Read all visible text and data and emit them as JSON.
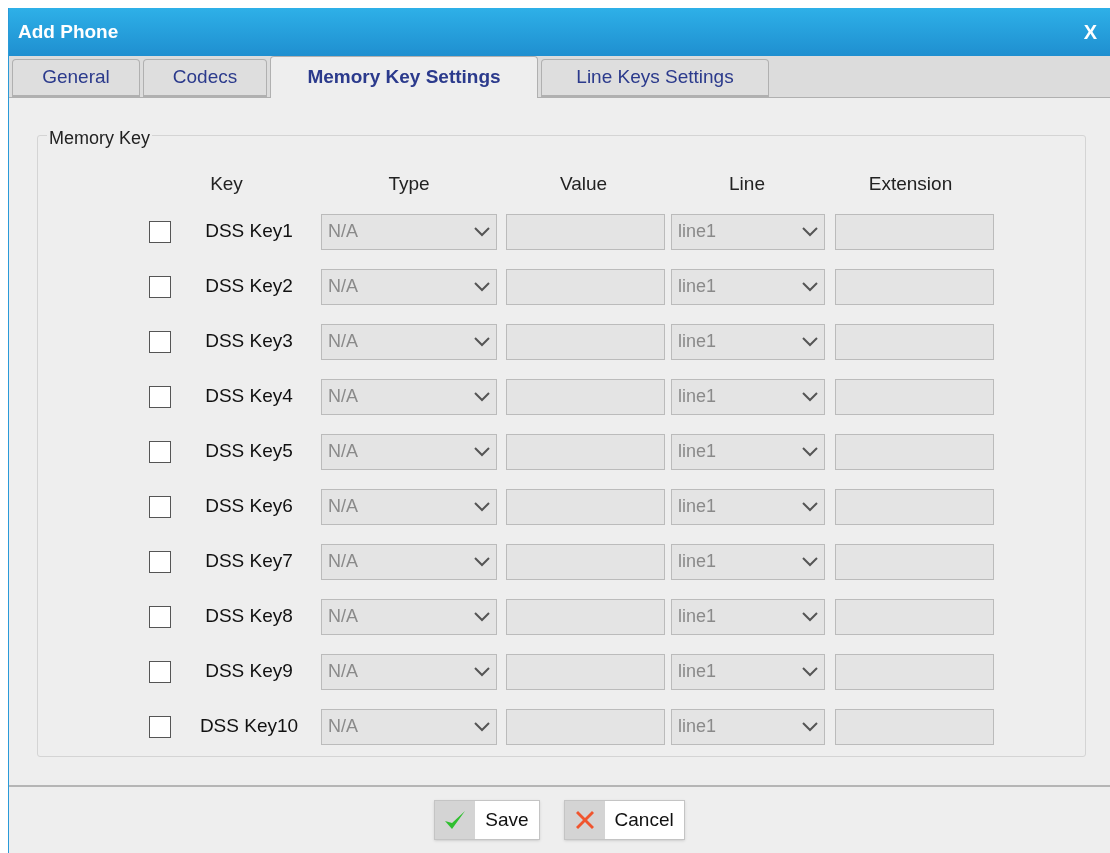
{
  "window": {
    "title": "Add Phone",
    "close": "X"
  },
  "tabs": [
    {
      "label": "General",
      "selected": false
    },
    {
      "label": "Codecs",
      "selected": false
    },
    {
      "label": "Memory Key Settings",
      "selected": true
    },
    {
      "label": "Line Keys Settings",
      "selected": false
    }
  ],
  "memory_key": {
    "legend": "Memory Key",
    "columns": [
      "Key",
      "Type",
      "Value",
      "Line",
      "Extension"
    ],
    "rows": [
      {
        "key": "DSS Key1",
        "checked": false,
        "type": "N/A",
        "line": "line1",
        "disabled": true
      },
      {
        "key": "DSS Key2",
        "checked": false,
        "type": "N/A",
        "line": "line1",
        "disabled": true
      },
      {
        "key": "DSS Key3",
        "checked": false,
        "type": "N/A",
        "line": "line1",
        "disabled": true
      },
      {
        "key": "DSS Key4",
        "checked": false,
        "type": "N/A",
        "line": "line1",
        "disabled": true
      },
      {
        "key": "DSS Key5",
        "checked": false,
        "type": "N/A",
        "line": "line1",
        "disabled": true
      },
      {
        "key": "DSS Key6",
        "checked": false,
        "type": "N/A",
        "line": "line1",
        "disabled": true
      },
      {
        "key": "DSS Key7",
        "checked": false,
        "type": "N/A",
        "line": "line1",
        "disabled": true
      },
      {
        "key": "DSS Key8",
        "checked": false,
        "type": "N/A",
        "line": "line1",
        "disabled": true
      },
      {
        "key": "DSS Key9",
        "checked": false,
        "type": "N/A",
        "line": "line1",
        "disabled": true
      },
      {
        "key": "DSS Key10",
        "checked": false,
        "type": "N/A",
        "line": "line1",
        "disabled": true
      }
    ]
  },
  "buttons": [
    {
      "kind": "save",
      "label": "Save"
    },
    {
      "kind": "cancel",
      "label": "Cancel"
    }
  ]
}
